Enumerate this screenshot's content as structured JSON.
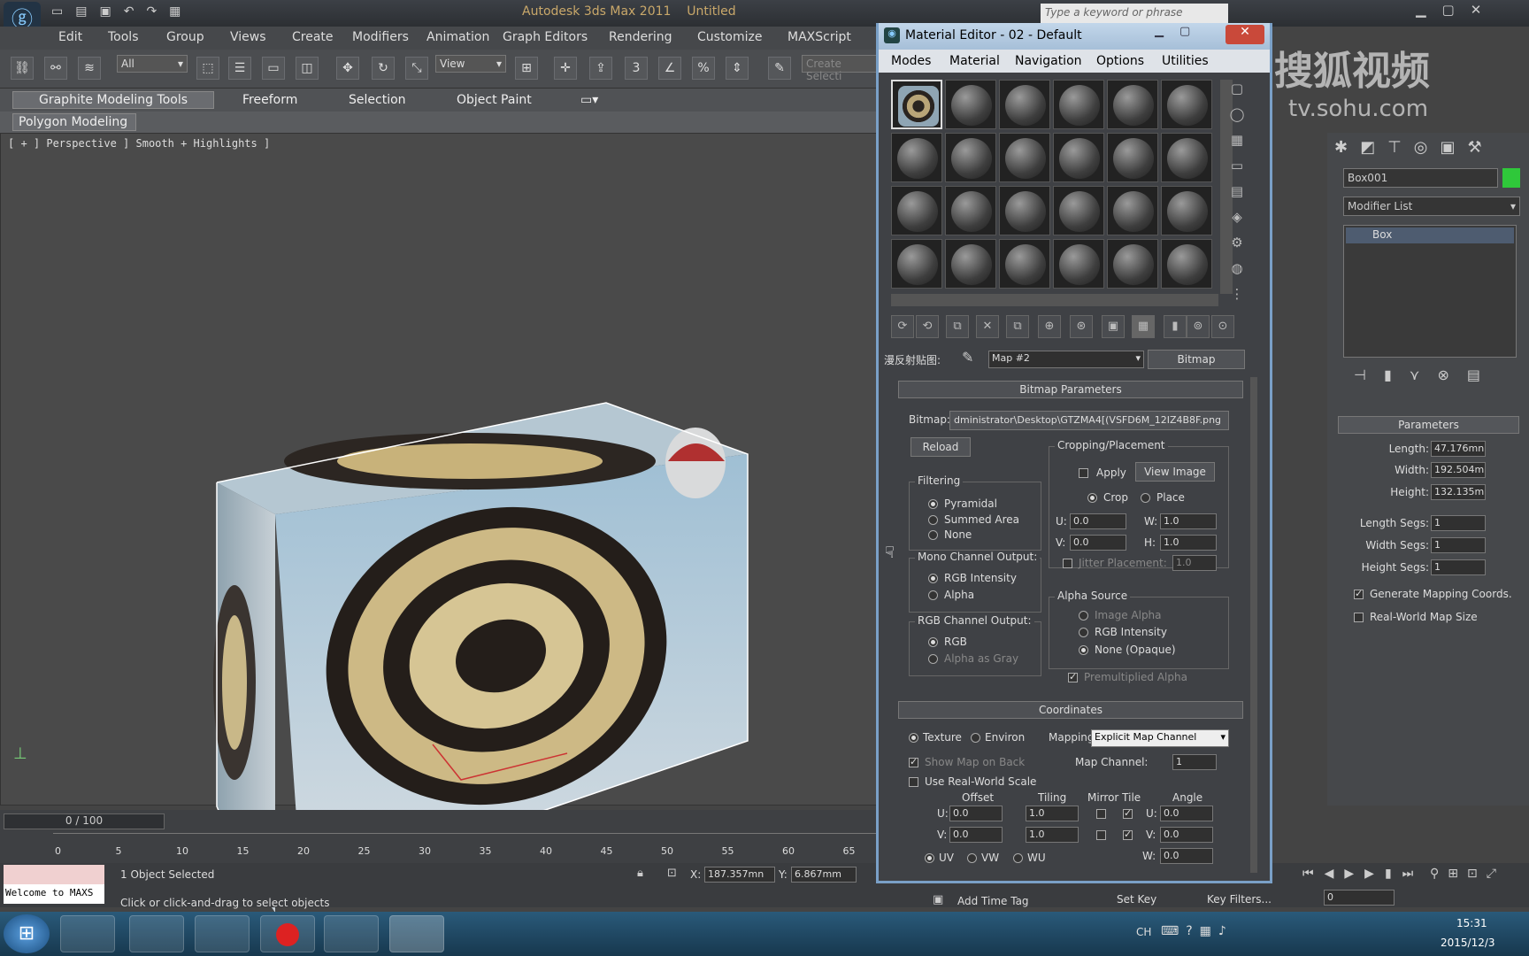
{
  "titlebar": {
    "title": "Autodesk 3ds Max  2011",
    "doc": "Untitled",
    "search_placeholder": "Type a keyword or phrase"
  },
  "menu": [
    "Edit",
    "Tools",
    "Group",
    "Views",
    "Create",
    "Modifiers",
    "Animation",
    "Graph Editors",
    "Rendering",
    "Customize",
    "MAXScript"
  ],
  "toolbar": {
    "selection_filter": "All",
    "ref_coord": "View",
    "snap_label": "3",
    "named_sel": "Create Selecti"
  },
  "ribbon": {
    "tabs": [
      "Graphite Modeling Tools",
      "Freeform",
      "Selection",
      "Object Paint"
    ],
    "sub": "Polygon Modeling"
  },
  "viewport": {
    "label": "[ + ] Perspective ] Smooth + Highlights ]"
  },
  "timeline": {
    "frame": "0 / 100",
    "ticks": [
      "0",
      "5",
      "10",
      "15",
      "20",
      "25",
      "30",
      "35",
      "40",
      "45",
      "50",
      "55",
      "60",
      "65"
    ]
  },
  "status": {
    "welcome": "Welcome to MAXS",
    "selected": "1 Object Selected",
    "hint": "Click or click-and-drag to select objects",
    "x_label": "X:",
    "x_val": "187.357mn",
    "y_label": "Y:",
    "y_val": "6.867mm",
    "add_time_tag": "Add Time Tag",
    "set_key": "Set Key",
    "key_filters": "Key Filters...",
    "frame_field": "0"
  },
  "taskbar": {
    "lang": "CH",
    "time": "15:31",
    "date": "2015/12/3"
  },
  "watermark": {
    "line1": "搜狐视频",
    "line2": "tv.sohu.com"
  },
  "command_panel": {
    "object_name": "Box001",
    "color": "#2fc83a",
    "modifier_list": "Modifier List",
    "stack_item": "Box",
    "params_title": "Parameters",
    "params": [
      {
        "label": "Length:",
        "value": "47.176mn"
      },
      {
        "label": "Width:",
        "value": "192.504m"
      },
      {
        "label": "Height:",
        "value": "132.135m"
      },
      {
        "label": "Length Segs:",
        "value": "1"
      },
      {
        "label": "Width Segs:",
        "value": "1"
      },
      {
        "label": "Height Segs:",
        "value": "1"
      }
    ],
    "gen_mapping": "Generate Mapping Coords.",
    "real_world": "Real-World Map Size"
  },
  "material_editor": {
    "title": "Material Editor - 02 - Default",
    "menu": [
      "Modes",
      "Material",
      "Navigation",
      "Options",
      "Utilities"
    ],
    "map_label": "漫反射贴图:",
    "map_name": "Map #2",
    "map_type": "Bitmap",
    "bitmap_params": "Bitmap Parameters",
    "bitmap_label": "Bitmap:",
    "bitmap_path": "dministrator\\Desktop\\GTZMA4[(VSFD6M_12IZ4B8F.png",
    "reload": "Reload",
    "cropping": "Cropping/Placement",
    "apply": "Apply",
    "view_image": "View Image",
    "crop": "Crop",
    "place": "Place",
    "u": "U:",
    "v": "V:",
    "w": "W:",
    "h": "H:",
    "u_val": "0.0",
    "v_val": "0.0",
    "w_val": "1.0",
    "h_val": "1.0",
    "jitter": "Jitter Placement:",
    "jitter_val": "1.0",
    "filtering": "Filtering",
    "filter_opts": [
      "Pyramidal",
      "Summed Area",
      "None"
    ],
    "mono": "Mono Channel Output:",
    "mono_opts": [
      "RGB Intensity",
      "Alpha"
    ],
    "rgb": "RGB Channel Output:",
    "rgb_opts": [
      "RGB",
      "Alpha as Gray"
    ],
    "alpha_src": "Alpha Source",
    "alpha_opts": [
      "Image Alpha",
      "RGB Intensity",
      "None (Opaque)"
    ],
    "premult": "Premultiplied Alpha",
    "coords": "Coordinates",
    "texture": "Texture",
    "environ": "Environ",
    "mapping_label": "Mapping:",
    "mapping_val": "Explicit Map Channel",
    "show_back": "Show Map on Back",
    "map_channel_label": "Map Channel:",
    "map_channel_val": "1",
    "use_real": "Use Real-World Scale",
    "offset": "Offset",
    "tiling": "Tiling",
    "mirror_tile": "Mirror Tile",
    "angle": "Angle",
    "u_off": "0.0",
    "v_off": "0.0",
    "u_tile": "1.0",
    "v_tile": "1.0",
    "u_ang": "0.0",
    "v_ang": "0.0",
    "w_ang": "0.0",
    "uvw": [
      "UV",
      "VW",
      "WU"
    ]
  }
}
